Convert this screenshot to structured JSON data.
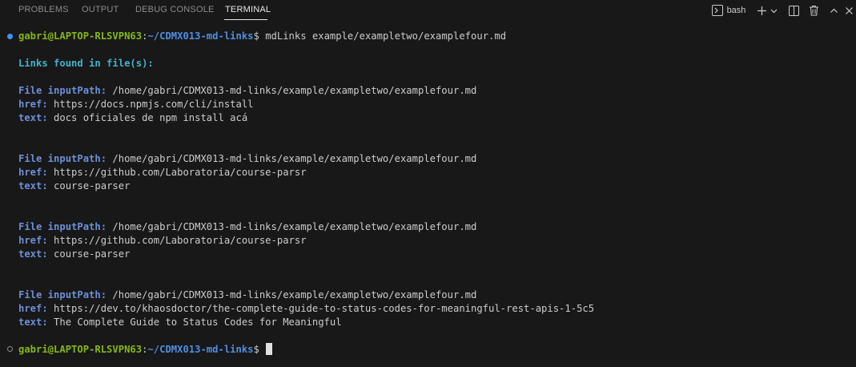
{
  "tabs": [
    "PROBLEMS",
    "OUTPUT",
    "DEBUG CONSOLE",
    "TERMINAL"
  ],
  "active_tab": "TERMINAL",
  "toolbar": {
    "shell_label": "bash",
    "icons": [
      "terminal-icon",
      "plus-icon",
      "chevron-down-icon",
      "split-terminal-icon",
      "trash-icon",
      "chevron-up-icon",
      "close-icon"
    ]
  },
  "prompt": {
    "user_host": "gabri@LAPTOP-RLSVPN63",
    "path": "~/CDMX013-md-links",
    "symbol": "$",
    "command": "mdLinks example/exampletwo/examplefour.md"
  },
  "output": {
    "heading": "Links found in file(s):",
    "file_key": "File inputPath:",
    "href_key": "href:",
    "text_key": "text:",
    "links": [
      {
        "file": "/home/gabri/CDMX013-md-links/example/exampletwo/examplefour.md",
        "href": "https://docs.npmjs.com/cli/install",
        "text": "docs oficiales de npm install acá"
      },
      {
        "file": "/home/gabri/CDMX013-md-links/example/exampletwo/examplefour.md",
        "href": "https://github.com/Laboratoria/course-parsr",
        "text": "course-parser"
      },
      {
        "file": "/home/gabri/CDMX013-md-links/example/exampletwo/examplefour.md",
        "href": "https://github.com/Laboratoria/course-parsr",
        "text": "course-parser"
      },
      {
        "file": "/home/gabri/CDMX013-md-links/example/exampletwo/examplefour.md",
        "href": "https://dev.to/khaosdoctor/the-complete-guide-to-status-codes-for-meaningful-rest-apis-1-5c5",
        "text": "The Complete Guide to Status Codes for Meaningful"
      }
    ]
  },
  "colors": {
    "background": "#181818",
    "prompt_user": "#84b61a",
    "prompt_path": "#4e8fe1",
    "heading": "#41b3c9",
    "key": "#6c8fd6",
    "decoration_success": "#3794ff"
  }
}
